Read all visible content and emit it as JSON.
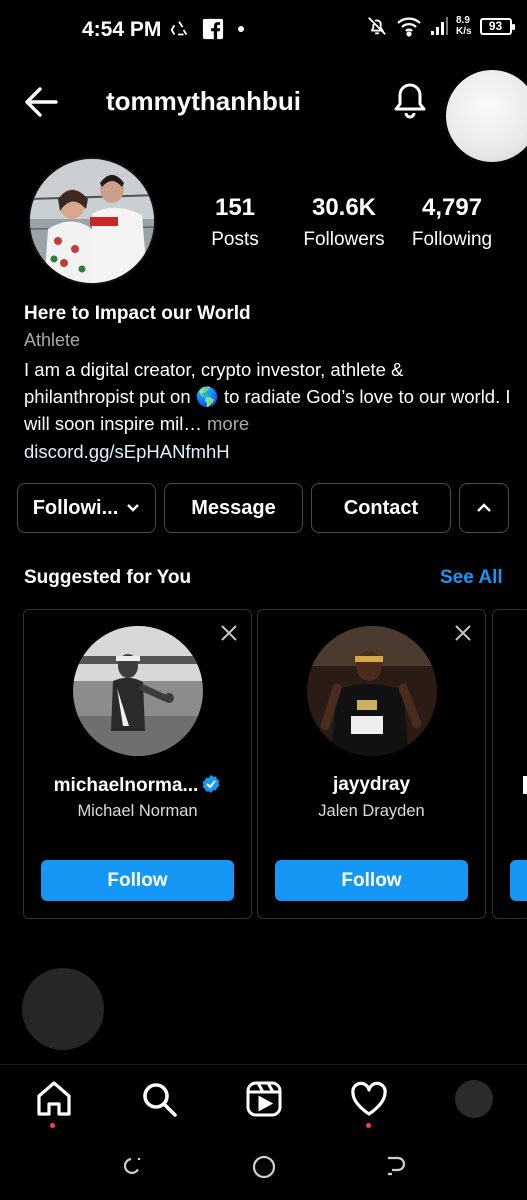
{
  "status_bar": {
    "time": "4:54 PM",
    "speed_value": "8.9",
    "speed_unit": "K/s",
    "battery": "93"
  },
  "header": {
    "username": "tommythanhbui",
    "back_icon": "back-arrow-icon",
    "bell_icon": "bell-icon"
  },
  "profile": {
    "stats": [
      {
        "value": "151",
        "label": "Posts"
      },
      {
        "value": "30.6K",
        "label": "Followers"
      },
      {
        "value": "4,797",
        "label": "Following"
      }
    ],
    "bio_name": "Here to Impact our World",
    "category": "Athlete",
    "bio_before_emoji": "I am a digital creator, crypto investor, athlete & philanthropist put on ",
    "bio_emoji": "🌎",
    "bio_after_emoji": " to radiate God’s love to our world. I will soon inspire mil… ",
    "bio_more": "more",
    "link": "discord.gg/sEpHANfmhH"
  },
  "actions": {
    "following_label": "Followi...",
    "message_label": "Message",
    "contact_label": "Contact"
  },
  "suggested": {
    "title": "Suggested for You",
    "see_all": "See All",
    "cards": [
      {
        "username": "michaelnorma...",
        "name": "Michael Norman",
        "follow_label": "Follow",
        "verified": true
      },
      {
        "username": "jayydray",
        "name": "Jalen Drayden",
        "follow_label": "Follow",
        "verified": false
      }
    ]
  },
  "colors": {
    "accent_blue": "#1597f5",
    "notification_dot": "#ff3b4e",
    "secondary_text": "#a8a8a8"
  },
  "tabbar": {
    "tabs": [
      "home-icon",
      "search-icon",
      "reels-icon",
      "heart-icon",
      "profile-avatar"
    ]
  }
}
